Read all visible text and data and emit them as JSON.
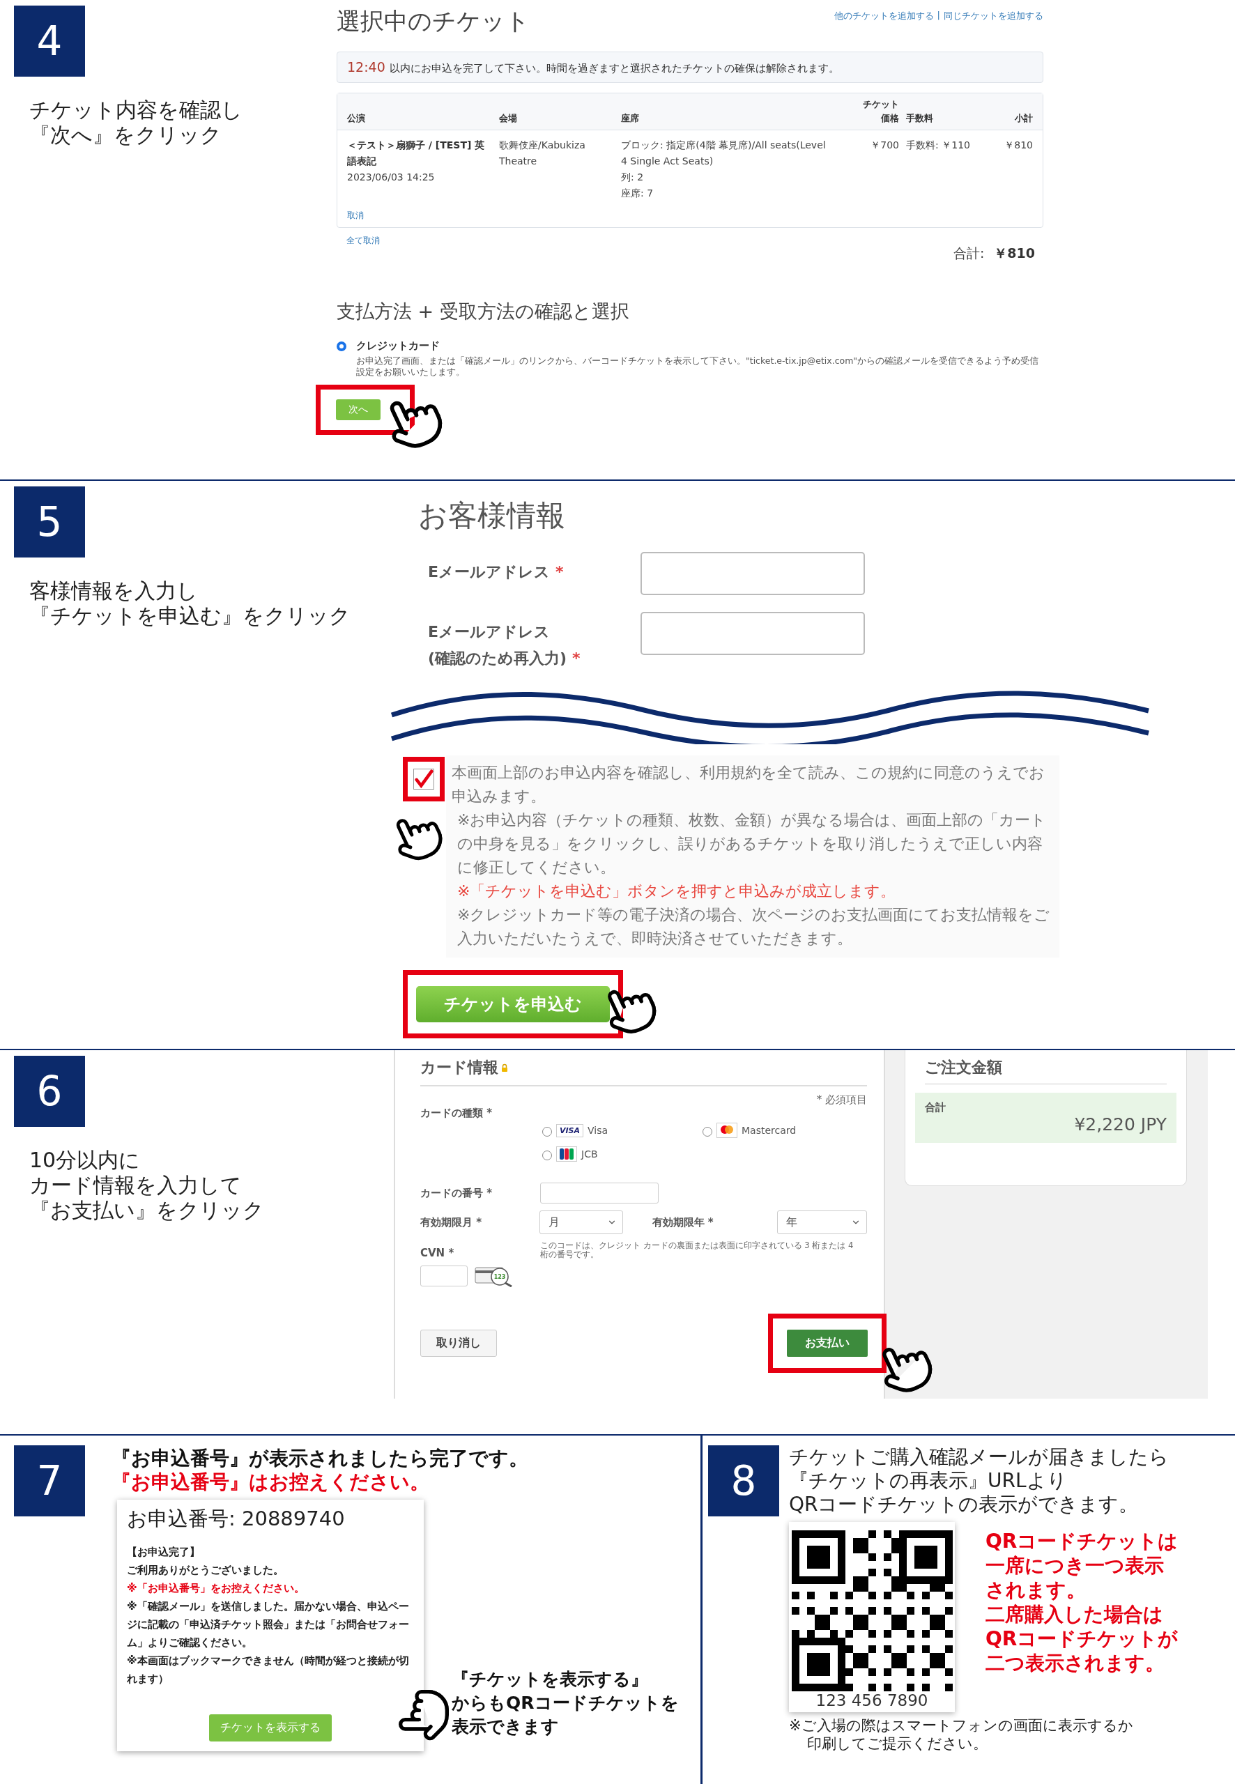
{
  "step4": {
    "number": "4",
    "instruction": [
      "チケット内容を確認し",
      "『次へ』をクリック"
    ],
    "title": "選択中のチケット",
    "links": [
      "他のチケットを追加する",
      "同じチケットを追加する"
    ],
    "link_separator": "|",
    "timer": "12:40",
    "notice": "以内にお申込を完了して下さい。時間を過ぎますと選択されたチケットの確保は解除されます。",
    "columns": [
      {
        "lines": [
          "公演"
        ]
      },
      {
        "lines": [
          "会場"
        ]
      },
      {
        "lines": [
          "座席"
        ]
      },
      {
        "lines": [
          "チケット",
          "価格"
        ]
      },
      {
        "lines": [
          "手数料"
        ]
      },
      {
        "lines": [
          "小計"
        ]
      }
    ],
    "row": {
      "performance": "＜テスト＞扇獅子 / [TEST] 英語表記",
      "date": "2023/06/03 14:25",
      "venue": "歌舞伎座/Kabukiza Theatre",
      "seat": [
        "ブロック: 指定席(4階 幕見席)/All seats(Level 4 Single Act Seats)",
        "列: 2",
        "座席: 7"
      ],
      "price": "￥700",
      "fee": "手数料: ￥110",
      "subtotal": "￥810",
      "cancel": "取消"
    },
    "cancel_all": "全て取消",
    "total_label": "合計:",
    "total": "￥810",
    "payment_heading": "支払方法 + 受取方法の確認と選択",
    "payment_option": {
      "label": "クレジットカード",
      "selected": true,
      "description": "お申込完了画面、または「確認メール」のリンクから、バーコードチケットを表示して下さい。\"ticket.e-tix.jp@etix.com\"からの確認メールを受信できるよう予め受信設定をお願いいたします。"
    },
    "next_button": "次へ"
  },
  "step5": {
    "number": "5",
    "instruction": [
      "客様情報を入力し",
      "『チケットを申込む』をクリック"
    ],
    "heading": "お客様情報",
    "fields": [
      {
        "label": [
          "Eメールアドレス"
        ],
        "required": "*"
      },
      {
        "label": [
          "Eメールアドレス",
          "(確認のため再入力)"
        ],
        "required": "*"
      }
    ],
    "agreement": {
      "checked": true,
      "text": "本画面上部のお申込内容を確認し、利用規約を全て読み、この規約に同意のうえでお申込みます。"
    },
    "notes": [
      {
        "kind": "normal",
        "text": "※お申込内容（チケットの種類、枚数、金額）が異なる場合は、画面上部の「カートの中身を見る」をクリックし、誤りがあるチケットを取り消したうえで正しい内容に修正してください。"
      },
      {
        "kind": "warning",
        "text": "※「チケットを申込む」ボタンを押すと申込みが成立します。"
      },
      {
        "kind": "normal",
        "text": "※クレジットカード等の電子決済の場合、次ページのお支払画面にてお支払情報をご入力いただいたうえで、即時決済させていただきます。"
      }
    ],
    "submit_button": "チケットを申込む"
  },
  "step6": {
    "number": "6",
    "instruction": [
      "10分以内に",
      "カード情報を入力して",
      "『お支払い』をクリック"
    ],
    "heading": "カード情報",
    "required_note": "* 必須項目",
    "card_type_label": "カードの種類 *",
    "card_types": [
      {
        "kind": "visa",
        "label": "Visa",
        "logo_text": "VISA",
        "selected": false
      },
      {
        "kind": "mastercard",
        "label": "Mastercard",
        "selected": false
      },
      {
        "kind": "jcb",
        "label": "JCB",
        "selected": false
      }
    ],
    "number_label": "カードの番号 *",
    "month_label": "有効期限月 *",
    "month_value": "月",
    "year_label": "有効期限年 *",
    "year_value": "年",
    "cvn_label": "CVN *",
    "cvn_help": "このコードは、クレジット カードの裏面または表面に印字されている 3 桁または 4 桁の番号です。",
    "cvn_icon_text": "123",
    "cancel_button": "取り消し",
    "pay_button": "お支払い",
    "summary": {
      "title": "ご注文金額",
      "total_label": "合計",
      "total": "¥2,220 JPY"
    }
  },
  "step7": {
    "number": "7",
    "headline": "『お申込番号』が表示されましたら完了です。",
    "headline_red": "『お申込番号』はお控えください。",
    "order_number": "お申込番号: 20889740",
    "lines": [
      {
        "kind": "normal",
        "text": "【お申込完了】"
      },
      {
        "kind": "normal",
        "text": "ご利用ありがとうございました。"
      },
      {
        "kind": "warning",
        "text": "※「お申込番号」をお控えください。"
      },
      {
        "kind": "normal",
        "text": "※「確認メール」を送信しました。届かない場合、申込ページに記載の「申込済チケット照会」または「お問合せフォーム」よりご確認ください。"
      },
      {
        "kind": "normal",
        "text": "※本画面はブックマークできません（時間が経つと接続が切れます）"
      }
    ],
    "show_ticket_button": "チケットを表示する",
    "callout": [
      "『チケットを表示する』",
      "からもQRコードチケットを",
      "表示できます"
    ]
  },
  "step8": {
    "number": "8",
    "text": [
      "チケットご購入確認メールが届きましたら",
      "『チケットの再表示』URLより",
      "QRコードチケットの表示ができます。"
    ],
    "qr_number": "123 456 7890",
    "note_red": [
      "QRコードチケットは",
      "一席につき一つ表示",
      "されます。",
      "二席購入した場合は",
      "QRコードチケットが",
      "二つ表示されます。"
    ],
    "footnote": [
      "※ご入場の際はスマートフォンの画面に表示するか",
      "印刷してご提示ください。"
    ]
  }
}
